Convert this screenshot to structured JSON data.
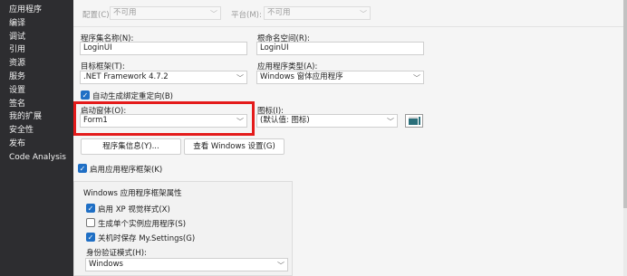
{
  "sidebar": {
    "items": [
      {
        "label": "应用程序"
      },
      {
        "label": "编译"
      },
      {
        "label": "调试"
      },
      {
        "label": "引用"
      },
      {
        "label": "资源"
      },
      {
        "label": "服务"
      },
      {
        "label": "设置"
      },
      {
        "label": "签名"
      },
      {
        "label": "我的扩展"
      },
      {
        "label": "安全性"
      },
      {
        "label": "发布"
      },
      {
        "label": "Code Analysis"
      }
    ]
  },
  "topbar": {
    "config_label": "配置(C):",
    "config_value": "不可用",
    "platform_label": "平台(M):",
    "platform_value": "不可用"
  },
  "assembly": {
    "label": "程序集名称(N):",
    "value": "LoginUI"
  },
  "root_namespace": {
    "label": "根命名空间(R):",
    "value": "LoginUI"
  },
  "target_framework": {
    "label": "目标框架(T):",
    "value": ".NET Framework 4.7.2"
  },
  "app_type": {
    "label": "应用程序类型(A):",
    "value": "Windows 窗体应用程序"
  },
  "auto_binding": {
    "label": "自动生成绑定重定向(B)",
    "checked": true
  },
  "startup_form": {
    "label": "启动窗体(O):",
    "value": "Form1"
  },
  "icon": {
    "label": "图标(I):",
    "value": "(默认值: 图标)"
  },
  "buttons": {
    "assembly_info": "程序集信息(Y)...",
    "view_windows_settings": "查看 Windows 设置(G)"
  },
  "enable_framework": {
    "label": "启用应用程序框架(K)",
    "checked": true
  },
  "framework_props": {
    "title": "Windows 应用程序框架属性",
    "xp_styles": {
      "label": "启用 XP 视觉样式(X)",
      "checked": true
    },
    "single_instance": {
      "label": "生成单个实例应用程序(S)",
      "checked": false
    },
    "save_settings": {
      "label": "关机时保存 My.Settings(G)",
      "checked": true
    },
    "auth_mode_label": "身份验证模式(H):",
    "auth_mode_value": "Windows"
  },
  "colors": {
    "sidebar_bg": "#2d2d30",
    "accent": "#1f6fc5",
    "highlight": "#e41b1b"
  }
}
